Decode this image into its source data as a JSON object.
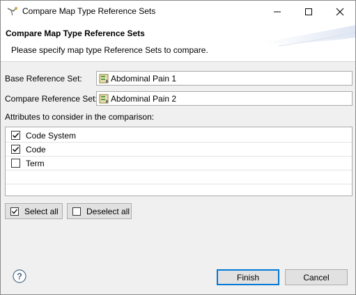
{
  "window": {
    "title": "Compare Map Type Reference Sets",
    "icon": "eclipse-wizard-icon",
    "controls": [
      "minimize-icon",
      "maximize-icon",
      "close-icon"
    ]
  },
  "banner": {
    "title": "Compare Map Type Reference Sets",
    "message": "Please specify map type Reference Sets to compare."
  },
  "form": {
    "base_label": "Base Reference Set:",
    "base_value": "Abdominal Pain 1",
    "compare_label": "Compare Reference Set:",
    "compare_value": "Abdominal Pain 2",
    "field_icon": "refset-icon",
    "attributes_label": "Attributes to consider in the comparison:"
  },
  "attributes": [
    {
      "label": "Code System",
      "checked": true
    },
    {
      "label": "Code",
      "checked": true
    },
    {
      "label": "Term",
      "checked": false
    }
  ],
  "buttons": {
    "select_all": "Select all",
    "deselect_all": "Deselect all",
    "finish": "Finish",
    "cancel": "Cancel"
  },
  "colors": {
    "accent": "#0078d7",
    "background": "#f0f0f0",
    "check": "#000000"
  }
}
